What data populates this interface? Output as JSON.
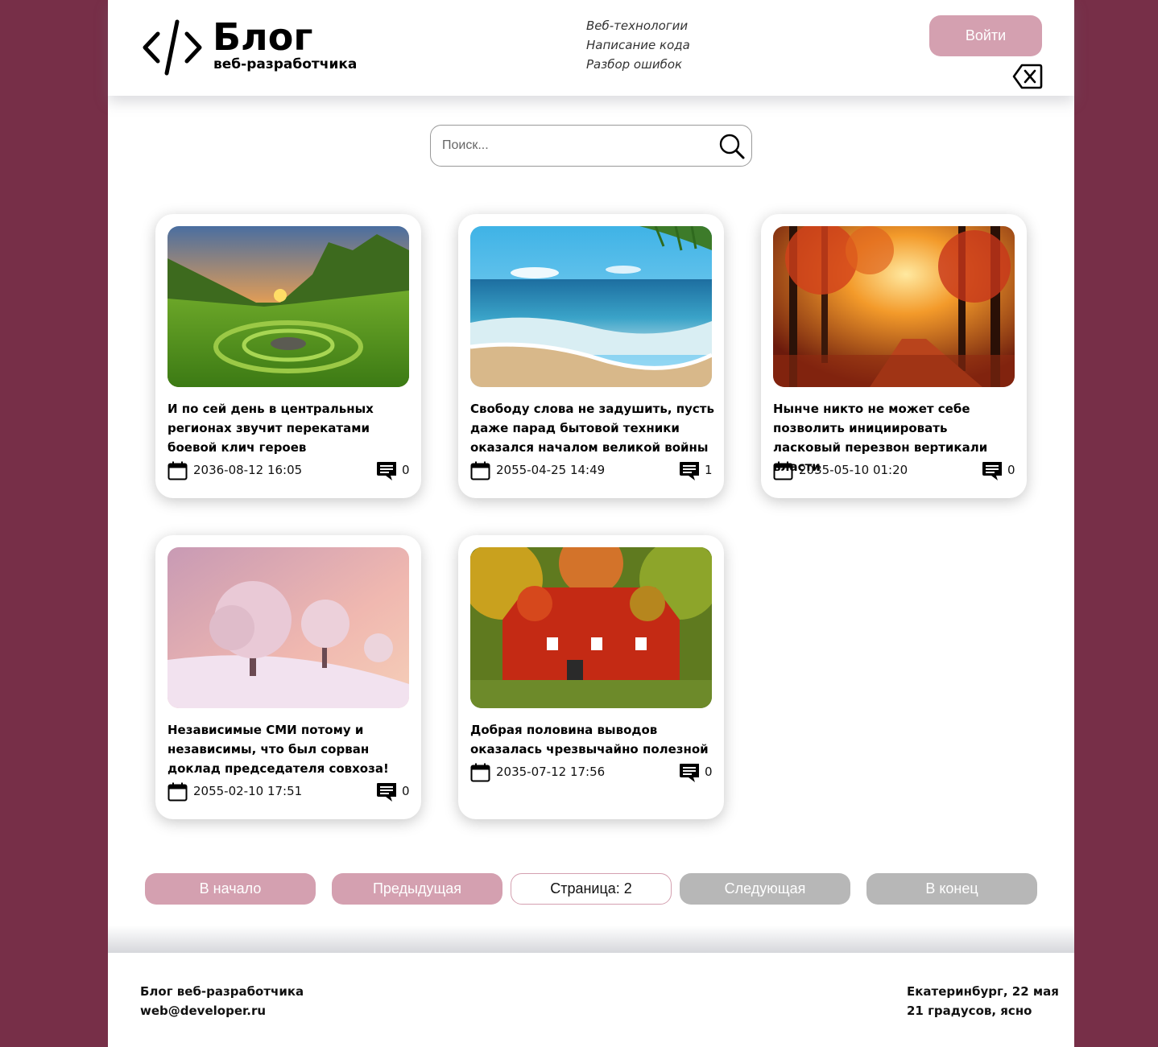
{
  "header": {
    "logo_title": "Блог",
    "logo_subtitle": "веб-разработчика",
    "topics": [
      "Веб-технологии",
      "Написание кода",
      "Разбор ошибок"
    ],
    "login_label": "Войти"
  },
  "search": {
    "placeholder": "Поиск..."
  },
  "posts": [
    {
      "title": "И по сей день в центральных регионах звучит перекатами боевой клич героев",
      "date": "2036-08-12 16:05",
      "comments": "0",
      "image": "green valley with spiral grass at sunset"
    },
    {
      "title": "Свободу слова не задушить, пусть даже парад бытовой техники оказался началом великой войны",
      "date": "2055-04-25 14:49",
      "comments": "1",
      "image": "sea beach with waves and palm leaves"
    },
    {
      "title": "Нынче никто не может себе позволить инициировать ласковый перезвон вертикали власти",
      "date": "2035-05-10 01:20",
      "comments": "0",
      "image": "autumn forest road with red trees"
    },
    {
      "title": "Независимые СМИ потому и независимы, что был сорван доклад председателя совхоза!",
      "date": "2055-02-10 17:51",
      "comments": "0",
      "image": "snowy trees on pink sunrise hill"
    },
    {
      "title": "Добрая половина выводов оказалась чрезвычайно полезной",
      "date": "2035-07-12 17:56",
      "comments": "0",
      "image": "house covered in red ivy in autumn"
    }
  ],
  "pagination": {
    "first": "В начало",
    "prev": "Предыдущая",
    "current": "Страница: 2",
    "next": "Следующая",
    "last": "В конец"
  },
  "footer": {
    "site_name": "Блог веб-разработчика",
    "email": "web@developer.ru",
    "weather_place_date": "Екатеринбург, 22 мая",
    "weather_text": "21 градусов, ясно"
  },
  "colors": {
    "background": "#772f48",
    "accent_pink": "#d4a0b0",
    "disabled_gray": "#b7b7b7"
  }
}
